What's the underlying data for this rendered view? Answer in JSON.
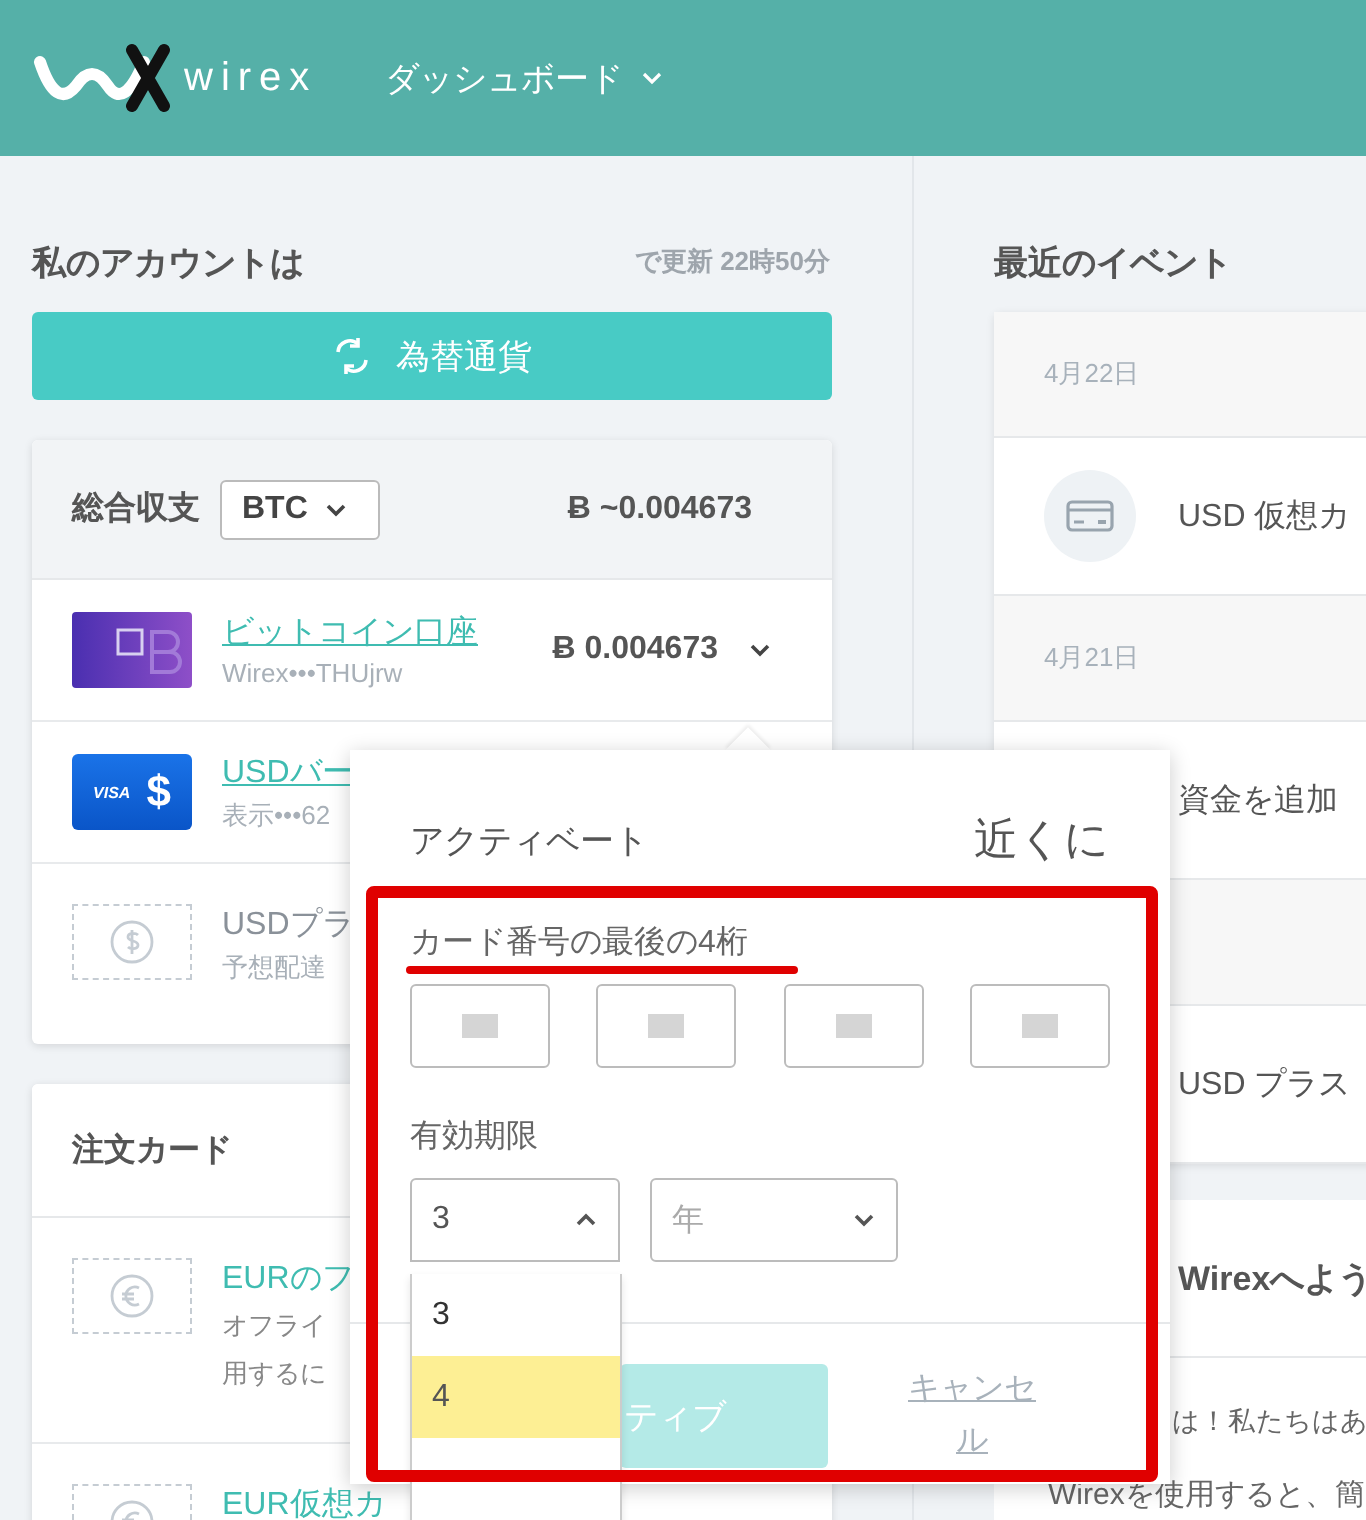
{
  "header": {
    "logo": "wirex",
    "nav": "ダッシュボード"
  },
  "accounts": {
    "title": "私のアカウントは",
    "updated": "で更新 22時50分",
    "exchange_button": "為替通貨",
    "total": {
      "label": "総合収支",
      "currency": "BTC",
      "amount": "Ƀ ~0.004673"
    },
    "items": [
      {
        "kind": "bitcoin",
        "name": "ビットコイン口座",
        "detail": "Wirex•••THUjrw",
        "balance": "Ƀ 0.004673"
      },
      {
        "kind": "visa",
        "name": "USDバー",
        "detail": "表示•••62",
        "card_label": "VISA",
        "card_symbol": "$"
      },
      {
        "kind": "planned",
        "name": "USDプラ",
        "detail": "予想配達"
      }
    ]
  },
  "order_cards": {
    "title": "注文カード",
    "items": [
      {
        "kind": "euro",
        "name": "EURのフ",
        "lines": [
          "オフライ",
          "用するに"
        ]
      },
      {
        "kind": "euro",
        "name": "EUR仮想カ"
      }
    ]
  },
  "events": {
    "title": "最近のイベント",
    "rows": [
      {
        "kind": "date",
        "text": "4月22日"
      },
      {
        "kind": "card_event",
        "text": "USD 仮想カ"
      },
      {
        "kind": "date",
        "text": "4月21日"
      },
      {
        "kind": "event",
        "text": "資金を追加"
      },
      {
        "kind": "date"
      },
      {
        "kind": "event",
        "text": "USD プラス"
      }
    ]
  },
  "welcome": {
    "title": "Wirexへよう",
    "lines": [
      "は！私たちはあ",
      "Wirexを使用すると、簡"
    ]
  },
  "popover": {
    "title": "アクティベート",
    "link": "近くに",
    "digits_label": "カード番号の最後の4桁",
    "digit_fields": [
      {
        "masked": true
      },
      {
        "masked": true
      },
      {
        "masked": true
      },
      {
        "masked": true
      }
    ],
    "expiry_label": "有効期限",
    "month": {
      "value": "3",
      "expanded": true,
      "options": [
        {
          "label": "3",
          "selected": true,
          "highlighted": false
        },
        {
          "label": "4",
          "selected": false,
          "highlighted": true
        }
      ]
    },
    "year": {
      "placeholder": "年",
      "expanded": false
    },
    "activate_button": {
      "label": "ティブ",
      "disabled": true
    },
    "cancel_link": "キャンセル"
  }
}
